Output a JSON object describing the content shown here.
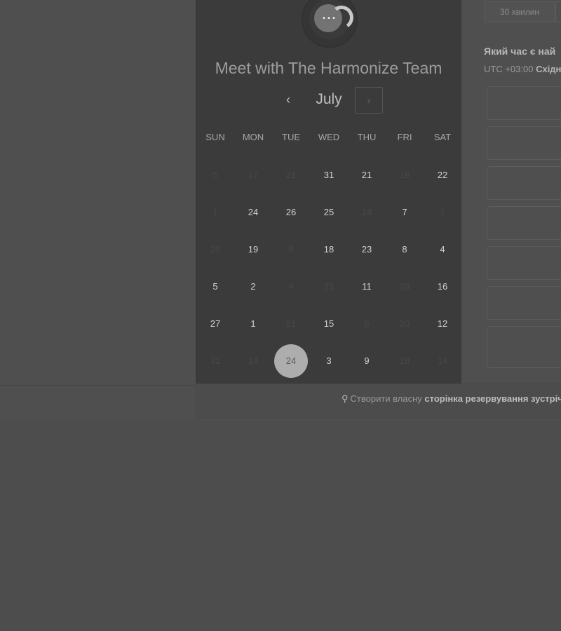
{
  "meeting": {
    "title": "Meet with The Harmonize Team",
    "logo_icon": "chat-bubble-dots-icon"
  },
  "calendar": {
    "month": "July",
    "prev_icon": "chevron-left-icon",
    "next_icon": "chevron-right-icon",
    "prev_glyph": "‹",
    "next_glyph": "›",
    "weekdays": [
      "SUN",
      "MON",
      "TUE",
      "WED",
      "THU",
      "FRI",
      "SAT"
    ],
    "weeks": [
      [
        {
          "d": "5",
          "dim": true
        },
        {
          "d": "17",
          "dim": true
        },
        {
          "d": "21",
          "dim": true
        },
        {
          "d": "31",
          "dim": false
        },
        {
          "d": "21",
          "dim": false
        },
        {
          "d": "19",
          "dim": true
        },
        {
          "d": "22",
          "dim": false
        }
      ],
      [
        {
          "d": "1",
          "dim": true
        },
        {
          "d": "24",
          "dim": false
        },
        {
          "d": "26",
          "dim": false
        },
        {
          "d": "25",
          "dim": false
        },
        {
          "d": "14",
          "dim": true
        },
        {
          "d": "7",
          "dim": false
        },
        {
          "d": "1",
          "dim": true
        }
      ],
      [
        {
          "d": "25",
          "dim": true
        },
        {
          "d": "19",
          "dim": false
        },
        {
          "d": "8",
          "dim": true
        },
        {
          "d": "18",
          "dim": false
        },
        {
          "d": "23",
          "dim": false
        },
        {
          "d": "8",
          "dim": false
        },
        {
          "d": "4",
          "dim": false
        }
      ],
      [
        {
          "d": "5",
          "dim": false
        },
        {
          "d": "2",
          "dim": false
        },
        {
          "d": "4",
          "dim": true
        },
        {
          "d": "25",
          "dim": true
        },
        {
          "d": "11",
          "dim": false
        },
        {
          "d": "28",
          "dim": true
        },
        {
          "d": "16",
          "dim": false
        }
      ],
      [
        {
          "d": "27",
          "dim": false
        },
        {
          "d": "1",
          "dim": false
        },
        {
          "d": "21",
          "dim": true
        },
        {
          "d": "15",
          "dim": false
        },
        {
          "d": "6",
          "dim": true
        },
        {
          "d": "20",
          "dim": true
        },
        {
          "d": "12",
          "dim": false
        }
      ],
      [
        {
          "d": "31",
          "dim": true
        },
        {
          "d": "14",
          "dim": true
        },
        {
          "d": "24",
          "dim": false,
          "selected": true
        },
        {
          "d": "3",
          "dim": false
        },
        {
          "d": "9",
          "dim": false
        },
        {
          "d": "18",
          "dim": true
        },
        {
          "d": "14",
          "dim": true
        }
      ]
    ]
  },
  "scheduler": {
    "duration_tab": "30 хвилин",
    "question": "Який час є най",
    "tz_prefix": "UTC +03:00",
    "tz_name": "Східн",
    "slot_count": 7
  },
  "footer": {
    "icon": "hubspot-sprocket-icon",
    "icon_glyph": "⚲",
    "text": "Створити власну",
    "link": "сторінка резервування зустрічей"
  }
}
